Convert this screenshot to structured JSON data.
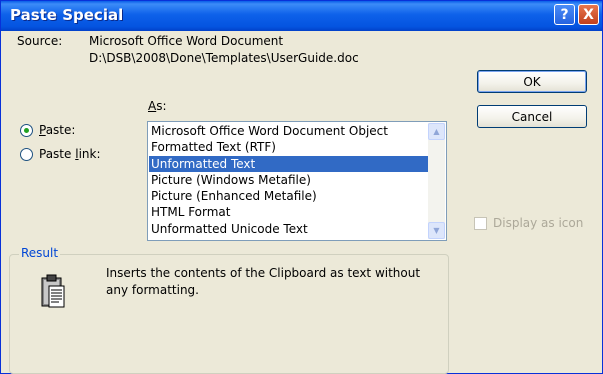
{
  "dialog": {
    "title": "Paste Special",
    "help_label": "?",
    "close_label": "X"
  },
  "source": {
    "label": "Source:",
    "line1": "Microsoft Office Word Document",
    "line2": "D:\\DSB\\2008\\Done\\Templates\\UserGuide.doc"
  },
  "as_label": "As:",
  "paste_options": {
    "paste_label": "Paste:",
    "paste_selected": true,
    "paste_link_label": "Paste link:"
  },
  "formats": {
    "items": [
      "Microsoft Office Word Document Object",
      "Formatted Text (RTF)",
      "Unformatted Text",
      "Picture (Windows Metafile)",
      "Picture (Enhanced Metafile)",
      "HTML Format",
      "Unformatted Unicode Text"
    ],
    "selected_index": 2
  },
  "buttons": {
    "ok": "OK",
    "cancel": "Cancel"
  },
  "display_as_icon": {
    "label": "Display as icon",
    "checked": false,
    "enabled": false
  },
  "result": {
    "title": "Result",
    "line1": "Inserts the contents of the Clipboard as text without",
    "line2": "any formatting.",
    "icon": "clipboard-icon"
  },
  "colors": {
    "title_bar": "#0454e0",
    "selection": "#316ac5",
    "dialog_bg": "#ece9d8"
  }
}
